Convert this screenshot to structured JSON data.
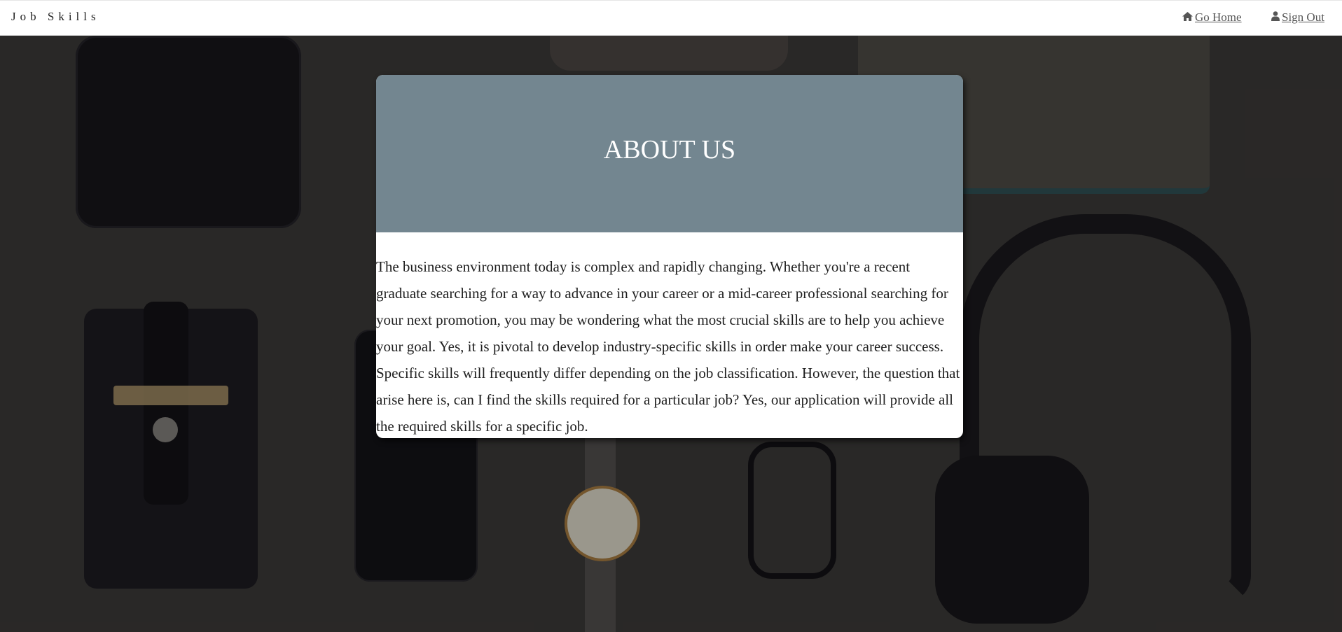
{
  "navbar": {
    "brand": "Job Skills",
    "links": [
      {
        "label": "Go Home",
        "icon": "home-icon"
      },
      {
        "label": "Sign Out",
        "icon": "user-icon"
      }
    ]
  },
  "about": {
    "title": "ABOUT US",
    "body": "The business environment today is complex and rapidly changing. Whether you're a recent graduate searching for a way to advance in your career or a mid-career professional searching for your next promotion, you may be wondering what the most crucial skills are to help you achieve your goal. Yes, it is pivotal to develop industry-specific skills in order make your career success. Specific skills will frequently differ depending on the job classification. However, the question that arise here is, can I find the skills required for a particular job? Yes, our application will provide all the required skills for a specific job."
  },
  "colors": {
    "header_bg": "#738690",
    "card_bg": "#ffffff",
    "navbar_bg": "#ffffff"
  }
}
